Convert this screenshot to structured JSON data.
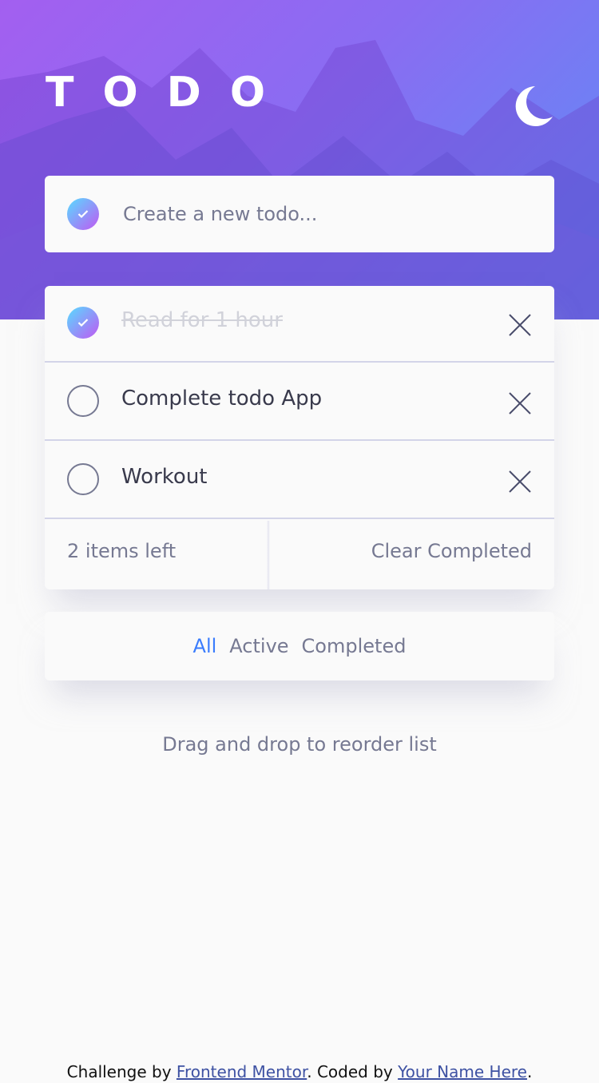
{
  "header": {
    "title": "TODO",
    "theme_icon": "moon-icon"
  },
  "new_todo": {
    "placeholder": "Create a new todo...",
    "check_icon": "check-icon"
  },
  "todos": [
    {
      "text": "Read for 1 hour",
      "completed": true
    },
    {
      "text": "Complete todo App",
      "completed": false
    },
    {
      "text": "Workout",
      "completed": false
    }
  ],
  "list_footer": {
    "items_left": "2 items left",
    "clear_label": "Clear Completed"
  },
  "filters": {
    "all": "All",
    "active": "Active",
    "completed": "Completed",
    "selected": "All"
  },
  "hint": "Drag and drop to reorder list",
  "attribution": {
    "prefix": "Challenge by ",
    "mentor_link": "Frontend Mentor",
    "middle": ". Coded by ",
    "author_link": "Your Name Here",
    "suffix": "."
  },
  "colors": {
    "accent": "#3a7cfd",
    "check_gradient_start": "#57ddff",
    "check_gradient_end": "#c058f3",
    "page_background": "#fafafa"
  }
}
